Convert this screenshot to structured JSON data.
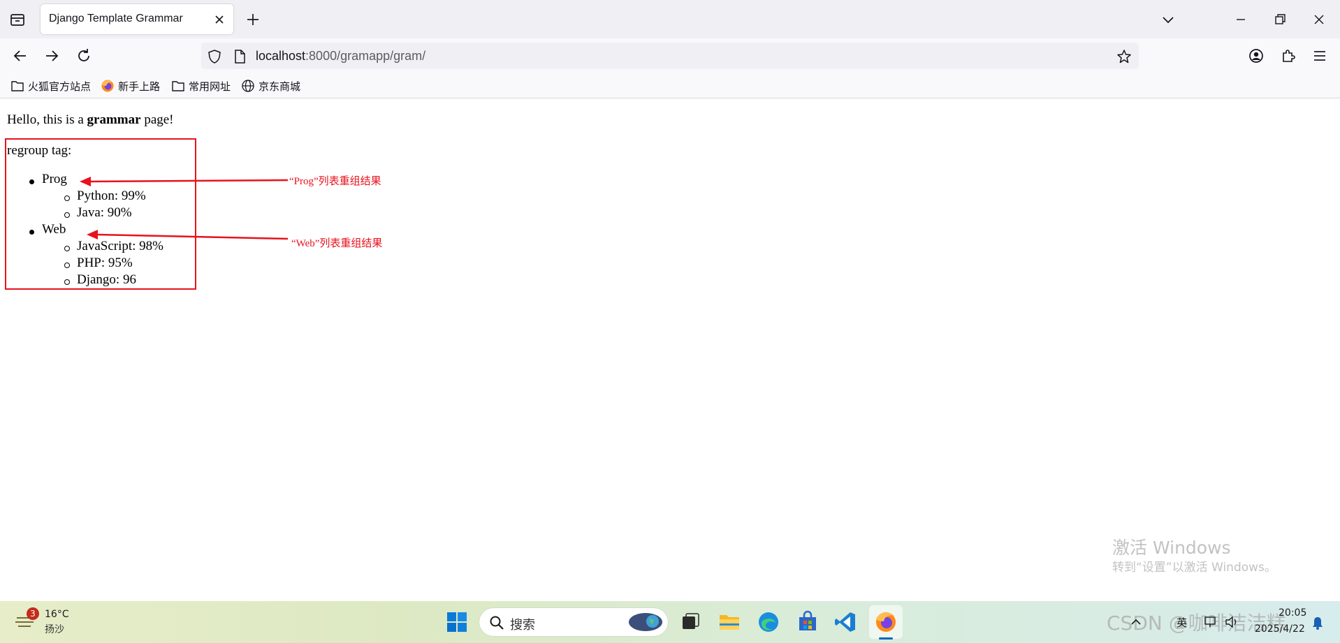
{
  "browser": {
    "tab_title": "Django Template Grammar",
    "url_host": "localhost",
    "url_rest": ":8000/gramapp/gram/",
    "bookmarks": [
      {
        "label": "火狐官方站点",
        "icon": "folder-icon"
      },
      {
        "label": "新手上路",
        "icon": "firefox-icon"
      },
      {
        "label": "常用网址",
        "icon": "folder-icon"
      },
      {
        "label": "京东商城",
        "icon": "globe-icon"
      }
    ]
  },
  "page": {
    "greeting_before": "Hello, this is a ",
    "greeting_bold": "grammar",
    "greeting_after": " page!",
    "section_title": "regroup tag:",
    "groups": [
      {
        "name": "Prog",
        "items": [
          "Python: 99%",
          "Java: 90%"
        ]
      },
      {
        "name": "Web",
        "items": [
          "JavaScript: 98%",
          "PHP: 95%",
          "Django: 96"
        ]
      }
    ],
    "annotations": [
      "“Prog”列表重组结果",
      "“Web”列表重组结果"
    ],
    "annotation_color": "#e8121d",
    "watermark_title": "激活 Windows",
    "watermark_sub": "转到“设置”以激活 Windows。"
  },
  "taskbar": {
    "weather_badge": "3",
    "weather_temp": "16°C",
    "weather_desc": "扬沙",
    "search_placeholder": "搜索",
    "ime": "英",
    "clock_time": "20:05",
    "clock_date": "2025/4/22",
    "csdn_watermark": "CSDN @咖啡洁洁糕"
  }
}
